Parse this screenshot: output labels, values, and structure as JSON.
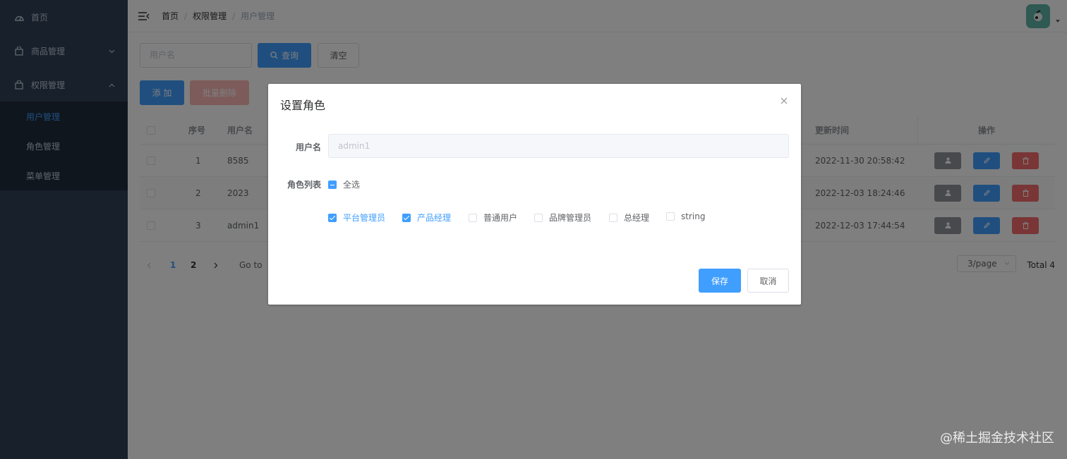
{
  "sidebar": {
    "home": "首页",
    "goods": "商品管理",
    "perm": "权限管理",
    "sub": [
      "用户管理",
      "角色管理",
      "菜单管理"
    ]
  },
  "header": {
    "breadcrumb": [
      "首页",
      "权限管理",
      "用户管理"
    ]
  },
  "toolbar": {
    "search_placeholder": "用户名",
    "query": "查询",
    "clear": "清空",
    "add": "添 加",
    "batch_delete": "批量删除"
  },
  "table": {
    "headers": {
      "index": "序号",
      "username": "用户名",
      "updated": "更新时间",
      "ops": "操作"
    },
    "rows": [
      {
        "index": "1",
        "username": "8585",
        "updated": "2022-11-30 20:58:42"
      },
      {
        "index": "2",
        "username": "2023",
        "updated": "2022-12-03 18:24:46"
      },
      {
        "index": "3",
        "username": "admin1",
        "updated": "2022-12-03 17:44:54"
      }
    ]
  },
  "pager": {
    "pages": [
      "1",
      "2"
    ],
    "goto": "Go to",
    "size": "3/page",
    "total": "Total 4"
  },
  "dialog": {
    "title": "设置角色",
    "username_label": "用户名",
    "username_value": "admin1",
    "roles_label": "角色列表",
    "select_all": "全选",
    "roles": [
      {
        "label": "平台管理员",
        "checked": true
      },
      {
        "label": "产品经理",
        "checked": true
      },
      {
        "label": "普通用户",
        "checked": false
      },
      {
        "label": "品牌管理员",
        "checked": false
      },
      {
        "label": "总经理",
        "checked": false
      },
      {
        "label": "string",
        "checked": false
      }
    ],
    "save": "保存",
    "cancel": "取消"
  },
  "watermark": "@稀土掘金技术社区",
  "colors": {
    "primary": "#409eff",
    "danger": "#f56c6c",
    "sidebar": "#304156"
  }
}
